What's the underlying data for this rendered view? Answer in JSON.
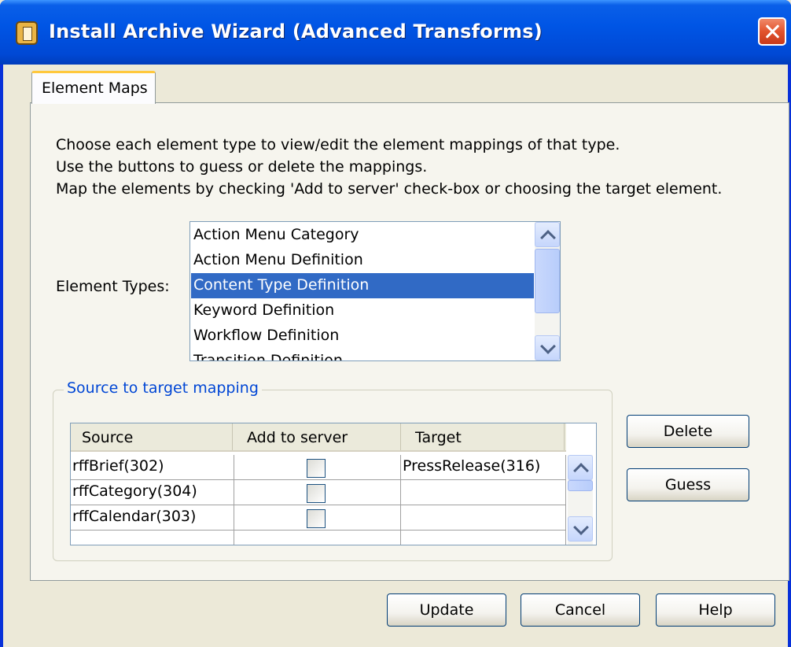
{
  "window": {
    "title": "Install Archive Wizard (Advanced Transforms)"
  },
  "tab": {
    "label": "Element Maps"
  },
  "instructions": [
    "Choose each element type to view/edit the element mappings of that type.",
    "Use the buttons to guess or delete the mappings.",
    "Map the elements by checking 'Add to server' check-box or choosing the target element."
  ],
  "element_types": {
    "label": "Element Types:",
    "items": [
      "Action Menu Category",
      "Action Menu Definition",
      "Content Type Definition",
      "Keyword Definition",
      "Workflow Definition",
      "Transition Definition"
    ],
    "selected": "Content Type Definition"
  },
  "mapping": {
    "group_label": "Source to target mapping",
    "columns": [
      "Source",
      "Add to server",
      "Target"
    ],
    "rows": [
      {
        "source": "rffBrief(302)",
        "add_to_server": false,
        "target": "PressRelease(316)"
      },
      {
        "source": "rffCategory(304)",
        "add_to_server": false,
        "target": ""
      },
      {
        "source": "rffCalendar(303)",
        "add_to_server": false,
        "target": ""
      }
    ]
  },
  "buttons": {
    "delete": "Delete",
    "guess": "Guess",
    "update": "Update",
    "cancel": "Cancel",
    "help": "Help"
  },
  "colors": {
    "titlebar": "#0055e5",
    "selection": "#316ac5",
    "group_label": "#0046d5",
    "tab_highlight": "#ffc83c"
  },
  "icons": {
    "title": "archive-wizard-icon",
    "close": "close-icon"
  }
}
